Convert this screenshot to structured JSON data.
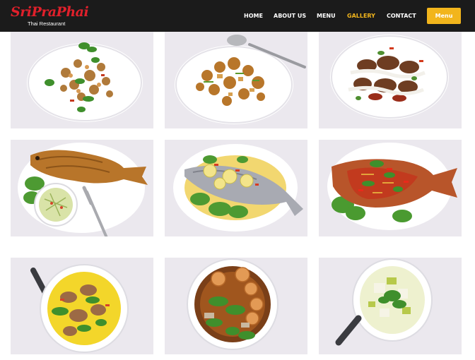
{
  "brand": {
    "logo_text": "SriPraPhai",
    "tagline": "Thai Restaurant"
  },
  "nav": {
    "items": [
      {
        "label": "HOME",
        "active": false
      },
      {
        "label": "ABOUT US",
        "active": false
      },
      {
        "label": "MENU",
        "active": false
      },
      {
        "label": "GALLERY",
        "active": true
      },
      {
        "label": "CONTACT",
        "active": false
      }
    ],
    "menu_button_label": "Menu"
  },
  "colors": {
    "navbar_bg": "#1b1b1b",
    "accent": "#f2b51c",
    "logo_red": "#e0202b",
    "tile_bg": "#eceaef"
  },
  "gallery": [
    {
      "dish": "stir-fried chicken with cilantro"
    },
    {
      "dish": "curry stir-fry with spoon"
    },
    {
      "dish": "grilled meat with cream sauce"
    },
    {
      "dish": "fried whole fish with papaya salad"
    },
    {
      "dish": "steamed fish with lime and chili"
    },
    {
      "dish": "fried fish with chili sauce"
    },
    {
      "dish": "yellow curry soup"
    },
    {
      "dish": "tom yum shrimp soup"
    },
    {
      "dish": "clear vegetable soup"
    }
  ]
}
